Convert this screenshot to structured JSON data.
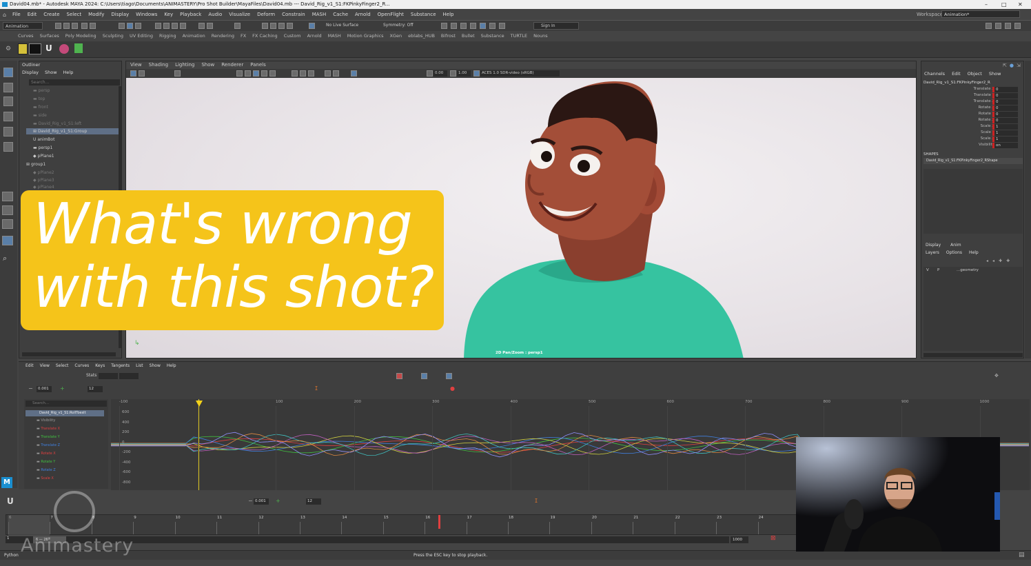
{
  "window": {
    "title": "David04.mb* - Autodesk MAYA 2024: C:\\Users\\tiago\\Documents\\ANIMASTERY\\Pro Shot Builder\\MayaFiles\\David04.mb   ---   David_Rig_v1_S1:FKPinkyFinger2_R...",
    "controls": [
      "–",
      "□",
      "✕"
    ]
  },
  "menubar": {
    "items": [
      "File",
      "Edit",
      "Create",
      "Select",
      "Modify",
      "Display",
      "Windows",
      "Key",
      "Playback",
      "Audio",
      "Visualize",
      "Deform",
      "Constrain",
      "MASH",
      "Cache",
      "Arnold",
      "OpenFlight",
      "Substance",
      "Help"
    ],
    "workspace_label": "Workspace:",
    "workspace_value": "Animation*"
  },
  "toolbar": {
    "menuset": "Animation",
    "live_surface": "No Live Surface",
    "symmetry": "Symmetry: Off",
    "sign_in": "Sign In"
  },
  "shelf": {
    "tabs": [
      "Curves",
      "Surfaces",
      "Poly Modeling",
      "Sculpting",
      "UV Editing",
      "Rigging",
      "Animation",
      "Rendering",
      "FX",
      "FX Caching",
      "Custom",
      "Arnold",
      "MASH",
      "Motion Graphics",
      "XGen",
      "eblabs_HUB",
      "Bifrost",
      "Bullet",
      "Substance",
      "TURTLE",
      "Nouns"
    ]
  },
  "outliner": {
    "title": "Outliner",
    "menu": [
      "Display",
      "Show",
      "Help"
    ],
    "search_placeholder": "Search...",
    "items": [
      {
        "label": "persp",
        "dim": true
      },
      {
        "label": "top",
        "dim": true
      },
      {
        "label": "front",
        "dim": true
      },
      {
        "label": "side",
        "dim": true
      },
      {
        "label": "David_Rig_v1_S1:left",
        "dim": true
      },
      {
        "label": "David_Rig_v1_S1:Group",
        "dim": false,
        "selected": true
      },
      {
        "label": "animBot",
        "dim": false
      },
      {
        "label": "persp1",
        "dim": false
      },
      {
        "label": "pPlane1",
        "dim": false
      },
      {
        "label": "group1",
        "dim": false
      },
      {
        "label": "pPlane2",
        "dim": true
      },
      {
        "label": "pPlane3",
        "dim": true
      },
      {
        "label": "pPlane4",
        "dim": true
      }
    ]
  },
  "viewport": {
    "menu": [
      "View",
      "Shading",
      "Lighting",
      "Show",
      "Renderer",
      "Panels"
    ],
    "exposure": "0.00",
    "gamma": "1.00",
    "color_space": "ACES 1.0 SDR-video (sRGB)",
    "camera_label": "2D Pan/Zoom : persp1"
  },
  "overlay": {
    "line1": "What's wrong",
    "line2": "with this shot?"
  },
  "channel_box": {
    "menu": [
      "Channels",
      "Edit",
      "Object",
      "Show"
    ],
    "object_name": "David_Rig_v1_S1:FKPinkyFinger2_R",
    "attributes": [
      {
        "label": "Translate X",
        "value": "0"
      },
      {
        "label": "Translate Y",
        "value": "0"
      },
      {
        "label": "Translate Z",
        "value": "0"
      },
      {
        "label": "Rotate X",
        "value": "0"
      },
      {
        "label": "Rotate Y",
        "value": "0"
      },
      {
        "label": "Rotate Z",
        "value": "0"
      },
      {
        "label": "Scale X",
        "value": "1"
      },
      {
        "label": "Scale Y",
        "value": "1"
      },
      {
        "label": "Scale Z",
        "value": "1"
      },
      {
        "label": "Visibility",
        "value": "on"
      }
    ],
    "shapes_label": "SHAPES",
    "shape_name": "David_Rig_v1_S1:FKPinkyFinger2_RShape",
    "layer_tabs": [
      "Display",
      "Anim"
    ],
    "layer_menu": [
      "Layers",
      "Options",
      "Help"
    ],
    "layer_row": {
      "v": "V",
      "p": "P",
      "name": "...geometry"
    }
  },
  "graph_editor": {
    "menu": [
      "Edit",
      "View",
      "Select",
      "Curves",
      "Keys",
      "Tangents",
      "List",
      "Show",
      "Help"
    ],
    "stats_label": "Stats",
    "step_value": "0.001",
    "frame_step": "12",
    "search_placeholder": "Search...",
    "root_node": "David_Rig_v1_S1:RollToeslt",
    "channels": [
      {
        "label": "Visibility",
        "color": "#999999"
      },
      {
        "label": "Translate X",
        "color": "#e04040"
      },
      {
        "label": "Translate Y",
        "color": "#40c040"
      },
      {
        "label": "Translate Z",
        "color": "#4080e0"
      },
      {
        "label": "Rotate X",
        "color": "#e04040"
      },
      {
        "label": "Rotate Y",
        "color": "#40c040"
      },
      {
        "label": "Rotate Z",
        "color": "#4080e0"
      },
      {
        "label": "Scale X",
        "color": "#e04040"
      }
    ],
    "y_ticks": [
      "600",
      "400",
      "200",
      "0",
      "-200",
      "-400",
      "-600",
      "-800"
    ],
    "x_ticks": [
      "-100",
      "0",
      "100",
      "200",
      "300",
      "400",
      "500",
      "600",
      "700",
      "800",
      "900",
      "1000"
    ],
    "current_frame": "16"
  },
  "timeslider": {
    "step_value": "0.001",
    "frame_step": "12",
    "frames": [
      "6",
      "7",
      "8",
      "9",
      "10",
      "11",
      "12",
      "13",
      "14",
      "15",
      "16",
      "17",
      "18",
      "19",
      "20",
      "21",
      "22",
      "23",
      "24"
    ],
    "range_start": "1",
    "range_inner": "6 — 26",
    "range_end": "1000",
    "current_frame": "16"
  },
  "statusbar": {
    "language": "Python",
    "message": "Press the ESC key to stop playback."
  },
  "watermark": {
    "text": "Animastery"
  },
  "badge": {
    "text": "M"
  },
  "colors": {
    "overlay": "#f5c41a",
    "maya_blue": "#1a8fd0",
    "key_red": "#cc2222",
    "playhead": "#f3d21a"
  }
}
